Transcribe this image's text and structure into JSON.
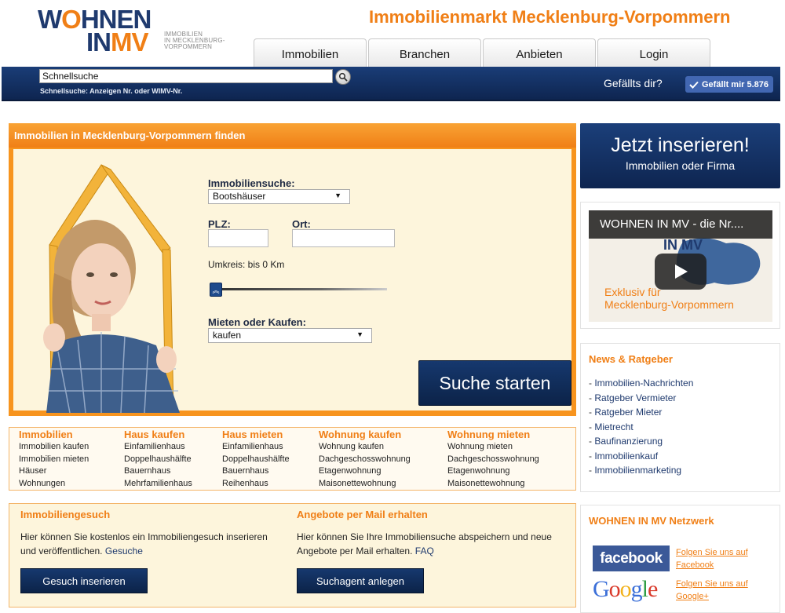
{
  "header": {
    "logo_line1_a": "W",
    "logo_line1_o": "O",
    "logo_line1_b": "HNEN",
    "logo_line2_a": "IN",
    "logo_line2_b": "MV",
    "logo_sub1": "IMMOBILIEN",
    "logo_sub2": "IN MECKLENBURG-",
    "logo_sub3": "VORPOMMERN",
    "site_title": "Immobilienmarkt Mecklenburg-Vorpommern",
    "tabs": [
      "Immobilien",
      "Branchen",
      "Anbieten",
      "Login"
    ]
  },
  "searchbar": {
    "value": "Schnellsuche",
    "hint": "Schnellsuche: Anzeigen Nr. oder WIMV-Nr.",
    "like_question": "Gefällts dir?",
    "like_button": "Gefällt mir 5.876"
  },
  "finder": {
    "title": "Immobilien in Mecklenburg-Vorpommern finden",
    "immo_label": "Immobiliensuche:",
    "immo_value": "Bootshäuser",
    "plz_label": "PLZ:",
    "ort_label": "Ort:",
    "umkreis_label": "Umkreis: bis 0 Km",
    "umkreis_km": 0,
    "mieten_label": "Mieten oder Kaufen:",
    "mieten_value": "kaufen",
    "search_button": "Suche starten"
  },
  "categories": [
    {
      "title": "Immobilien",
      "items": [
        "Immobilien kaufen",
        "Immobilien mieten",
        "Häuser",
        "Wohnungen"
      ]
    },
    {
      "title": "Haus kaufen",
      "items": [
        "Einfamilienhaus",
        "Doppelhaushälfte",
        "Bauernhaus",
        "Mehrfamilienhaus"
      ]
    },
    {
      "title": "Haus mieten",
      "items": [
        "Einfamilienhaus",
        "Doppelhaushälfte",
        "Bauernhaus",
        "Reihenhaus"
      ]
    },
    {
      "title": "Wohnung kaufen",
      "items": [
        "Wohnung kaufen",
        "Dachgeschosswohnung",
        "Etagenwohnung",
        "Maisonettewohnung"
      ]
    },
    {
      "title": "Wohnung mieten",
      "items": [
        "Wohnung mieten",
        "Dachgeschosswohnung",
        "Etagenwohnung",
        "Maisonettewohnung"
      ]
    }
  ],
  "gesuch": {
    "title": "Immobiliengesuch",
    "text": "Hier können Sie kostenlos ein Immobiliengesuch inserieren und veröffentlichen.",
    "link": "Gesuche",
    "button": "Gesuch inserieren"
  },
  "mail": {
    "title": "Angebote per Mail erhalten",
    "text": "Hier können Sie Ihre Immobiliensuche abspeichern und neue Angebote per Mail erhalten.",
    "link": "FAQ",
    "button": "Suchagent anlegen"
  },
  "promo": {
    "title": "Jetzt inserieren!",
    "subtitle": "Immobilien oder Firma"
  },
  "video": {
    "title": "WOHNEN IN MV - die Nr....",
    "caption1": "Exklusiv für",
    "caption2": "Mecklenburg-Vorpommern"
  },
  "news": {
    "title": "News & Ratgeber",
    "items": [
      "Immobilien-Nachrichten",
      "Ratgeber Vermieter",
      "Ratgeber Mieter",
      "Mietrecht",
      "Baufinanzierung",
      "Immobilienkauf",
      "Immobilienmarketing"
    ]
  },
  "network": {
    "title": "WOHNEN IN MV Netzwerk",
    "facebook_logo": "facebook",
    "facebook_link1": "Folgen Sie uns auf",
    "facebook_link2": "Facebook",
    "google_link1": "Folgen Sie uns auf",
    "google_link2": "Google+"
  },
  "colors": {
    "brand_orange": "#f07f16",
    "brand_navy": "#1f3a6e",
    "facebook_blue": "#3b5998"
  }
}
